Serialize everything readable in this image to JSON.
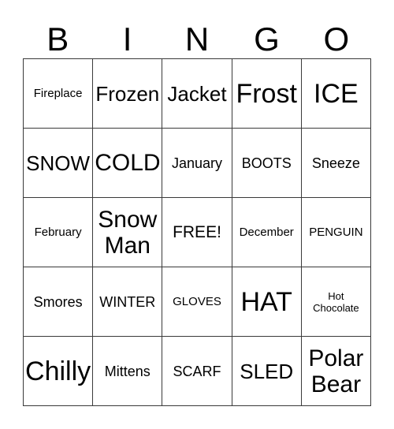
{
  "card": {
    "title": "BINGO",
    "header": {
      "letters": [
        {
          "label": "B"
        },
        {
          "label": "I"
        },
        {
          "label": "N"
        },
        {
          "label": "G"
        },
        {
          "label": "O"
        }
      ]
    },
    "colors": {
      "background": "#ffffff",
      "text": "#000000",
      "grid_line": "#3a3a3a"
    },
    "grid": {
      "columns": 5,
      "rows": 5,
      "free_space": "FREE!",
      "cells": [
        {
          "text": "Fireplace",
          "size": "sz-s",
          "column": "B",
          "row": 1
        },
        {
          "text": "Frozen",
          "size": "sz-xl",
          "column": "I",
          "row": 1
        },
        {
          "text": "Jacket",
          "size": "sz-xl",
          "column": "N",
          "row": 1
        },
        {
          "text": "Frost",
          "size": "sz-huge",
          "column": "G",
          "row": 1
        },
        {
          "text": "ICE",
          "size": "sz-huge",
          "column": "O",
          "row": 1
        },
        {
          "text": "SNOW",
          "size": "sz-xl",
          "column": "B",
          "row": 2
        },
        {
          "text": "COLD",
          "size": "sz-xxl",
          "column": "I",
          "row": 2
        },
        {
          "text": "January",
          "size": "sz-m",
          "column": "N",
          "row": 2
        },
        {
          "text": "BOOTS",
          "size": "sz-m",
          "column": "G",
          "row": 2
        },
        {
          "text": "Sneeze",
          "size": "sz-m",
          "column": "O",
          "row": 2
        },
        {
          "text": "February",
          "size": "sz-s",
          "column": "B",
          "row": 3
        },
        {
          "text": "Snow\nMan",
          "size": "sz-xxl",
          "column": "I",
          "row": 3
        },
        {
          "text": "FREE!",
          "size": "sz-l",
          "column": "N",
          "row": 3
        },
        {
          "text": "December",
          "size": "sz-s",
          "column": "G",
          "row": 3
        },
        {
          "text": "PENGUIN",
          "size": "sz-s",
          "column": "O",
          "row": 3
        },
        {
          "text": "Smores",
          "size": "sz-m",
          "column": "B",
          "row": 4
        },
        {
          "text": "WINTER",
          "size": "sz-m",
          "column": "I",
          "row": 4
        },
        {
          "text": "GLOVES",
          "size": "sz-s",
          "column": "N",
          "row": 4
        },
        {
          "text": "HAT",
          "size": "sz-huge",
          "column": "G",
          "row": 4
        },
        {
          "text": "Hot\nChocolate",
          "size": "sz-xs",
          "column": "O",
          "row": 4
        },
        {
          "text": "Chilly",
          "size": "sz-huge",
          "column": "B",
          "row": 5
        },
        {
          "text": "Mittens",
          "size": "sz-m",
          "column": "I",
          "row": 5
        },
        {
          "text": "SCARF",
          "size": "sz-m",
          "column": "N",
          "row": 5
        },
        {
          "text": "SLED",
          "size": "sz-xl",
          "column": "G",
          "row": 5
        },
        {
          "text": "Polar\nBear",
          "size": "sz-xxl",
          "column": "O",
          "row": 5
        }
      ]
    }
  }
}
